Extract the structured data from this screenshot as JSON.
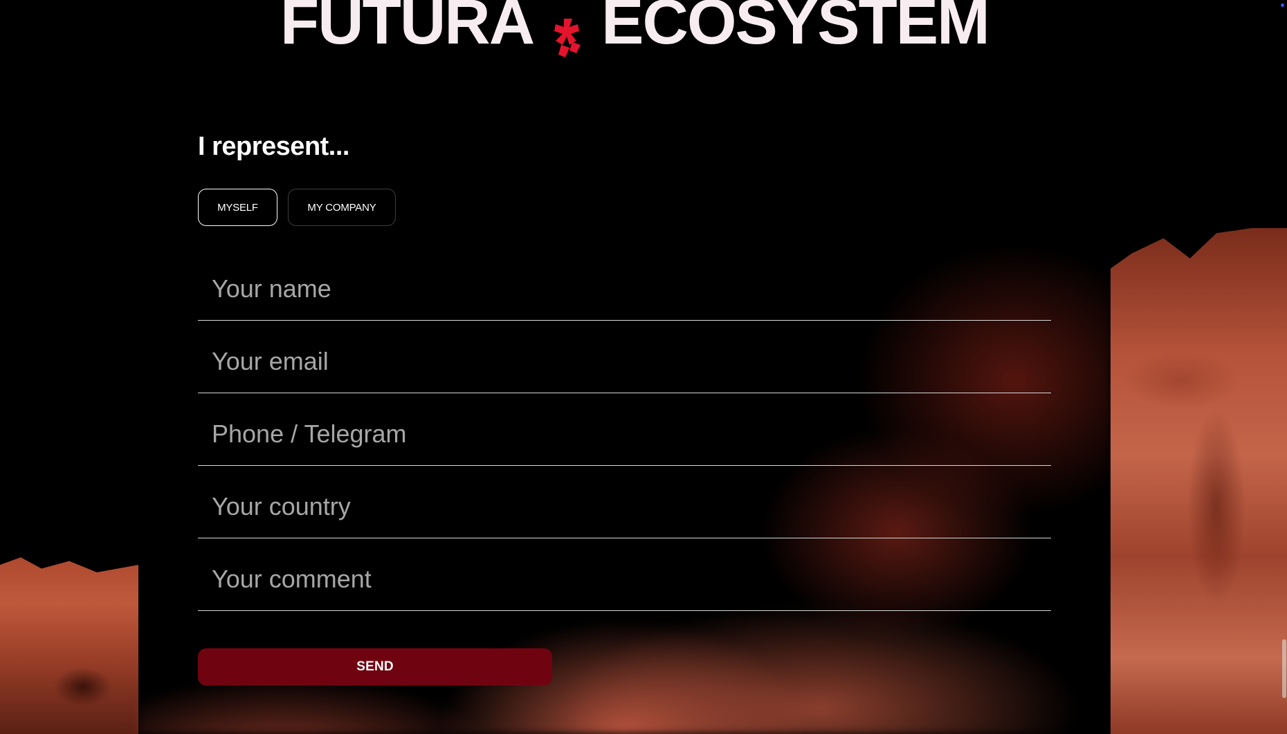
{
  "header": {
    "brand_left": "FUTURA",
    "brand_right": "ECOSYSTEM",
    "logo_icon": "futura-mark-icon",
    "logo_color": "#e4142c"
  },
  "form": {
    "heading": "I represent...",
    "choices": [
      {
        "label": "MYSELF",
        "selected": true
      },
      {
        "label": "MY COMPANY",
        "selected": false
      }
    ],
    "fields": [
      {
        "placeholder": "Your name",
        "value": ""
      },
      {
        "placeholder": "Your email",
        "value": ""
      },
      {
        "placeholder": "Phone / Telegram",
        "value": ""
      },
      {
        "placeholder": "Your country",
        "value": ""
      },
      {
        "placeholder": "Your comment",
        "value": ""
      }
    ],
    "submit_label": "SEND",
    "submit_color": "#6f0410"
  }
}
